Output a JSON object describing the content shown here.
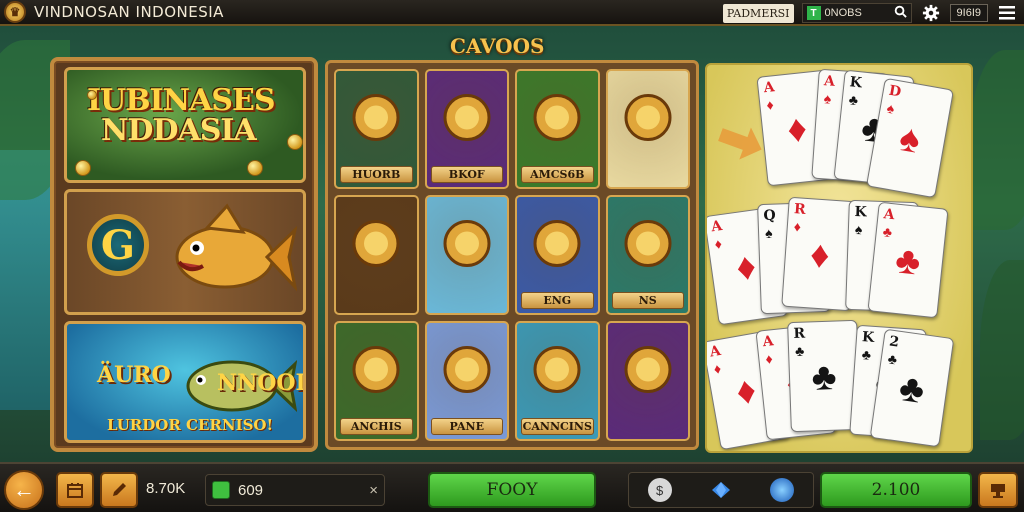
{
  "header": {
    "logo_glyph": "♛",
    "title": "VINDNOSAN INDONESIA",
    "promo_label": "PADMERSI",
    "search_badge": "T",
    "search_text": "0NOBS",
    "counter_badge": "9I6I9"
  },
  "section_title": "CAVOOS",
  "left_banners": {
    "banner1_line1": "IUBINASES",
    "banner1_line2": "NDDASIA",
    "banner2_emblem": "G",
    "banner3_text1": "ÄURO",
    "banner3_text2": "NNOOI",
    "banner3_text3": "LURDOR CERNISO!"
  },
  "tiles": [
    {
      "label": "HUORB",
      "bg": "#2f5a3a"
    },
    {
      "label": "BKOF",
      "bg": "#5a2a7a"
    },
    {
      "label": "AMCS6B",
      "bg": "#3a7a2a"
    },
    {
      "label": "",
      "bg": "#e8d9a0"
    },
    {
      "label": "",
      "bg": "#5a3a1a"
    },
    {
      "label": "",
      "bg": "#6ab8d8"
    },
    {
      "label": "ENG",
      "bg": "#3a5aa8"
    },
    {
      "label": "NS",
      "bg": "#2a7a6a"
    },
    {
      "label": "ANCHIS",
      "bg": "#3a6a2a"
    },
    {
      "label": "PANE",
      "bg": "#7a9ad8"
    },
    {
      "label": "CANNCINS",
      "bg": "#3a9ab8"
    },
    {
      "label": "",
      "bg": "#5a2a7a"
    }
  ],
  "cards": [
    {
      "rank": "A",
      "suit": "♦",
      "color": "red"
    },
    {
      "rank": "A",
      "suit": "♠",
      "color": "red"
    },
    {
      "rank": "K",
      "suit": "♣",
      "color": "black"
    },
    {
      "rank": "D",
      "suit": "♠",
      "color": "red"
    },
    {
      "rank": "A",
      "suit": "♦",
      "color": "red"
    },
    {
      "rank": "Q",
      "suit": "♠",
      "color": "black"
    },
    {
      "rank": "R",
      "suit": "♦",
      "color": "red"
    },
    {
      "rank": "K",
      "suit": "♠",
      "color": "black"
    },
    {
      "rank": "A",
      "suit": "♣",
      "color": "red"
    },
    {
      "rank": "A",
      "suit": "♦",
      "color": "red"
    },
    {
      "rank": "A",
      "suit": "♦",
      "color": "red"
    },
    {
      "rank": "R",
      "suit": "♣",
      "color": "black"
    },
    {
      "rank": "K",
      "suit": "♣",
      "color": "black"
    },
    {
      "rank": "2",
      "suit": "♣",
      "color": "black"
    }
  ],
  "footer": {
    "back_icon": "←",
    "balance": "8.70K",
    "wallet_amount": "609",
    "wallet_close": "×",
    "play_button": "FOOY",
    "bet_button": "2.100",
    "icons": [
      "coin-icon",
      "diamond-icon",
      "globe-icon"
    ]
  },
  "colors": {
    "accent_gold": "#f6c24e",
    "green_button": "#5fd64a",
    "frame": "#c08a3e"
  }
}
